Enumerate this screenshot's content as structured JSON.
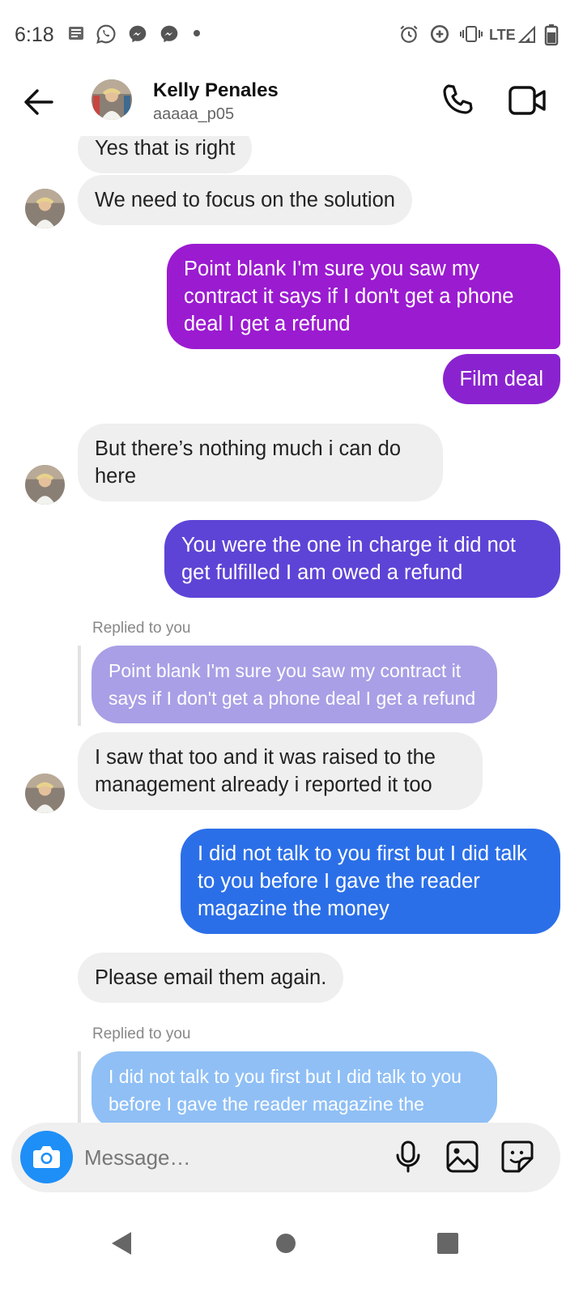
{
  "status_bar": {
    "time": "6:18",
    "network": "LTE",
    "left_icons": [
      "news-icon",
      "whatsapp-icon",
      "messenger-icon",
      "messenger-icon",
      "dot-icon"
    ],
    "right_icons": [
      "alarm-icon",
      "data-saver-icon",
      "vibrate-icon",
      "signal-icon",
      "battery-icon"
    ]
  },
  "header": {
    "name": "Kelly Penales",
    "handle": "aaaaa_p05",
    "icons": [
      "back-arrow-icon",
      "phone-icon",
      "video-icon"
    ]
  },
  "messages": [
    {
      "id": "m1",
      "from": "them",
      "text": "Yes that is right"
    },
    {
      "id": "m2",
      "from": "them",
      "text": "We need to focus on the solution"
    },
    {
      "id": "m3",
      "from": "me",
      "text": "Point blank I'm sure you saw my contract it says if I don't get a phone deal I get a refund"
    },
    {
      "id": "m4",
      "from": "me",
      "text": "Film deal"
    },
    {
      "id": "m5",
      "from": "them",
      "text": "But there’s nothing much i can do here"
    },
    {
      "id": "m6",
      "from": "me",
      "text": "You were the one in charge it did not get fulfilled I am owed a refund"
    },
    {
      "id": "m7",
      "from": "them",
      "replied_label": "Replied to you",
      "quote": "Point blank I'm sure you saw my contract it says if I don't get a phone deal I get a refund",
      "text": "I saw that too and it was raised to the management already i reported it too"
    },
    {
      "id": "m8",
      "from": "me",
      "text": "I did not talk to you first but I did talk to you before I gave the reader magazine the money"
    },
    {
      "id": "m9",
      "from": "them",
      "text": "Please email them again."
    },
    {
      "id": "m10",
      "from": "them",
      "replied_label": "Replied to you",
      "quote": "I did not talk to you first but I did talk to you before I gave the reader magazine the"
    }
  ],
  "composer": {
    "placeholder": "Message…",
    "icons": [
      "camera-icon",
      "microphone-icon",
      "gallery-icon",
      "sticker-icon"
    ]
  },
  "nav_bar": {
    "icons": [
      "back-triangle-icon",
      "home-circle-icon",
      "recents-square-icon"
    ]
  },
  "colors": {
    "gradient_top": "#9b1bd0",
    "gradient_mid": "#5e44d6",
    "gradient_bottom": "#2b6fe8",
    "incoming_bubble": "#efefef",
    "camera_button": "#1e8ff7"
  }
}
